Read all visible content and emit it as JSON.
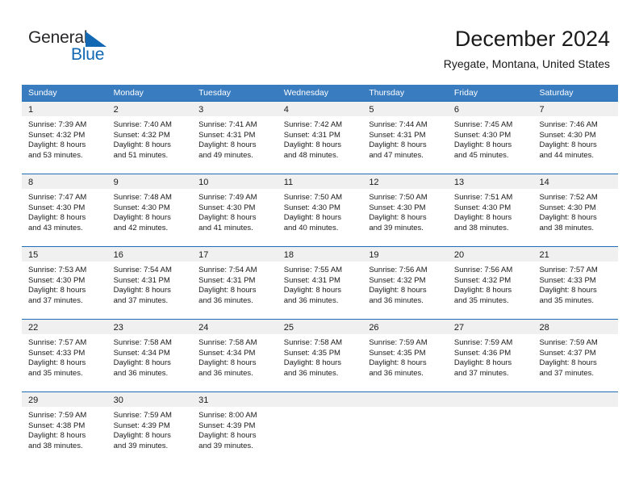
{
  "brand": {
    "name_part1": "General",
    "name_part2": "Blue",
    "triangle_color": "#1268b3",
    "text_color": "#28282b"
  },
  "header": {
    "title": "December 2024",
    "subtitle": "Ryegate, Montana, United States"
  },
  "theme": {
    "header_blue": "#3a7cc0",
    "cell_border_blue": "#1f6eb5",
    "daynum_band": "#f0f0f0"
  },
  "weekdays": [
    "Sunday",
    "Monday",
    "Tuesday",
    "Wednesday",
    "Thursday",
    "Friday",
    "Saturday"
  ],
  "labels": {
    "sunrise_prefix": "Sunrise:",
    "sunset_prefix": "Sunset:",
    "daylight_prefix": "Daylight:"
  },
  "weeks": [
    [
      {
        "day": "1",
        "sunrise": "Sunrise: 7:39 AM",
        "sunset": "Sunset: 4:32 PM",
        "daylight_line1": "Daylight: 8 hours",
        "daylight_line2": "and 53 minutes."
      },
      {
        "day": "2",
        "sunrise": "Sunrise: 7:40 AM",
        "sunset": "Sunset: 4:32 PM",
        "daylight_line1": "Daylight: 8 hours",
        "daylight_line2": "and 51 minutes."
      },
      {
        "day": "3",
        "sunrise": "Sunrise: 7:41 AM",
        "sunset": "Sunset: 4:31 PM",
        "daylight_line1": "Daylight: 8 hours",
        "daylight_line2": "and 49 minutes."
      },
      {
        "day": "4",
        "sunrise": "Sunrise: 7:42 AM",
        "sunset": "Sunset: 4:31 PM",
        "daylight_line1": "Daylight: 8 hours",
        "daylight_line2": "and 48 minutes."
      },
      {
        "day": "5",
        "sunrise": "Sunrise: 7:44 AM",
        "sunset": "Sunset: 4:31 PM",
        "daylight_line1": "Daylight: 8 hours",
        "daylight_line2": "and 47 minutes."
      },
      {
        "day": "6",
        "sunrise": "Sunrise: 7:45 AM",
        "sunset": "Sunset: 4:30 PM",
        "daylight_line1": "Daylight: 8 hours",
        "daylight_line2": "and 45 minutes."
      },
      {
        "day": "7",
        "sunrise": "Sunrise: 7:46 AM",
        "sunset": "Sunset: 4:30 PM",
        "daylight_line1": "Daylight: 8 hours",
        "daylight_line2": "and 44 minutes."
      }
    ],
    [
      {
        "day": "8",
        "sunrise": "Sunrise: 7:47 AM",
        "sunset": "Sunset: 4:30 PM",
        "daylight_line1": "Daylight: 8 hours",
        "daylight_line2": "and 43 minutes."
      },
      {
        "day": "9",
        "sunrise": "Sunrise: 7:48 AM",
        "sunset": "Sunset: 4:30 PM",
        "daylight_line1": "Daylight: 8 hours",
        "daylight_line2": "and 42 minutes."
      },
      {
        "day": "10",
        "sunrise": "Sunrise: 7:49 AM",
        "sunset": "Sunset: 4:30 PM",
        "daylight_line1": "Daylight: 8 hours",
        "daylight_line2": "and 41 minutes."
      },
      {
        "day": "11",
        "sunrise": "Sunrise: 7:50 AM",
        "sunset": "Sunset: 4:30 PM",
        "daylight_line1": "Daylight: 8 hours",
        "daylight_line2": "and 40 minutes."
      },
      {
        "day": "12",
        "sunrise": "Sunrise: 7:50 AM",
        "sunset": "Sunset: 4:30 PM",
        "daylight_line1": "Daylight: 8 hours",
        "daylight_line2": "and 39 minutes."
      },
      {
        "day": "13",
        "sunrise": "Sunrise: 7:51 AM",
        "sunset": "Sunset: 4:30 PM",
        "daylight_line1": "Daylight: 8 hours",
        "daylight_line2": "and 38 minutes."
      },
      {
        "day": "14",
        "sunrise": "Sunrise: 7:52 AM",
        "sunset": "Sunset: 4:30 PM",
        "daylight_line1": "Daylight: 8 hours",
        "daylight_line2": "and 38 minutes."
      }
    ],
    [
      {
        "day": "15",
        "sunrise": "Sunrise: 7:53 AM",
        "sunset": "Sunset: 4:30 PM",
        "daylight_line1": "Daylight: 8 hours",
        "daylight_line2": "and 37 minutes."
      },
      {
        "day": "16",
        "sunrise": "Sunrise: 7:54 AM",
        "sunset": "Sunset: 4:31 PM",
        "daylight_line1": "Daylight: 8 hours",
        "daylight_line2": "and 37 minutes."
      },
      {
        "day": "17",
        "sunrise": "Sunrise: 7:54 AM",
        "sunset": "Sunset: 4:31 PM",
        "daylight_line1": "Daylight: 8 hours",
        "daylight_line2": "and 36 minutes."
      },
      {
        "day": "18",
        "sunrise": "Sunrise: 7:55 AM",
        "sunset": "Sunset: 4:31 PM",
        "daylight_line1": "Daylight: 8 hours",
        "daylight_line2": "and 36 minutes."
      },
      {
        "day": "19",
        "sunrise": "Sunrise: 7:56 AM",
        "sunset": "Sunset: 4:32 PM",
        "daylight_line1": "Daylight: 8 hours",
        "daylight_line2": "and 36 minutes."
      },
      {
        "day": "20",
        "sunrise": "Sunrise: 7:56 AM",
        "sunset": "Sunset: 4:32 PM",
        "daylight_line1": "Daylight: 8 hours",
        "daylight_line2": "and 35 minutes."
      },
      {
        "day": "21",
        "sunrise": "Sunrise: 7:57 AM",
        "sunset": "Sunset: 4:33 PM",
        "daylight_line1": "Daylight: 8 hours",
        "daylight_line2": "and 35 minutes."
      }
    ],
    [
      {
        "day": "22",
        "sunrise": "Sunrise: 7:57 AM",
        "sunset": "Sunset: 4:33 PM",
        "daylight_line1": "Daylight: 8 hours",
        "daylight_line2": "and 35 minutes."
      },
      {
        "day": "23",
        "sunrise": "Sunrise: 7:58 AM",
        "sunset": "Sunset: 4:34 PM",
        "daylight_line1": "Daylight: 8 hours",
        "daylight_line2": "and 36 minutes."
      },
      {
        "day": "24",
        "sunrise": "Sunrise: 7:58 AM",
        "sunset": "Sunset: 4:34 PM",
        "daylight_line1": "Daylight: 8 hours",
        "daylight_line2": "and 36 minutes."
      },
      {
        "day": "25",
        "sunrise": "Sunrise: 7:58 AM",
        "sunset": "Sunset: 4:35 PM",
        "daylight_line1": "Daylight: 8 hours",
        "daylight_line2": "and 36 minutes."
      },
      {
        "day": "26",
        "sunrise": "Sunrise: 7:59 AM",
        "sunset": "Sunset: 4:35 PM",
        "daylight_line1": "Daylight: 8 hours",
        "daylight_line2": "and 36 minutes."
      },
      {
        "day": "27",
        "sunrise": "Sunrise: 7:59 AM",
        "sunset": "Sunset: 4:36 PM",
        "daylight_line1": "Daylight: 8 hours",
        "daylight_line2": "and 37 minutes."
      },
      {
        "day": "28",
        "sunrise": "Sunrise: 7:59 AM",
        "sunset": "Sunset: 4:37 PM",
        "daylight_line1": "Daylight: 8 hours",
        "daylight_line2": "and 37 minutes."
      }
    ],
    [
      {
        "day": "29",
        "sunrise": "Sunrise: 7:59 AM",
        "sunset": "Sunset: 4:38 PM",
        "daylight_line1": "Daylight: 8 hours",
        "daylight_line2": "and 38 minutes."
      },
      {
        "day": "30",
        "sunrise": "Sunrise: 7:59 AM",
        "sunset": "Sunset: 4:39 PM",
        "daylight_line1": "Daylight: 8 hours",
        "daylight_line2": "and 39 minutes."
      },
      {
        "day": "31",
        "sunrise": "Sunrise: 8:00 AM",
        "sunset": "Sunset: 4:39 PM",
        "daylight_line1": "Daylight: 8 hours",
        "daylight_line2": "and 39 minutes."
      },
      {
        "day": "",
        "sunrise": "",
        "sunset": "",
        "daylight_line1": "",
        "daylight_line2": ""
      },
      {
        "day": "",
        "sunrise": "",
        "sunset": "",
        "daylight_line1": "",
        "daylight_line2": ""
      },
      {
        "day": "",
        "sunrise": "",
        "sunset": "",
        "daylight_line1": "",
        "daylight_line2": ""
      },
      {
        "day": "",
        "sunrise": "",
        "sunset": "",
        "daylight_line1": "",
        "daylight_line2": ""
      }
    ]
  ]
}
